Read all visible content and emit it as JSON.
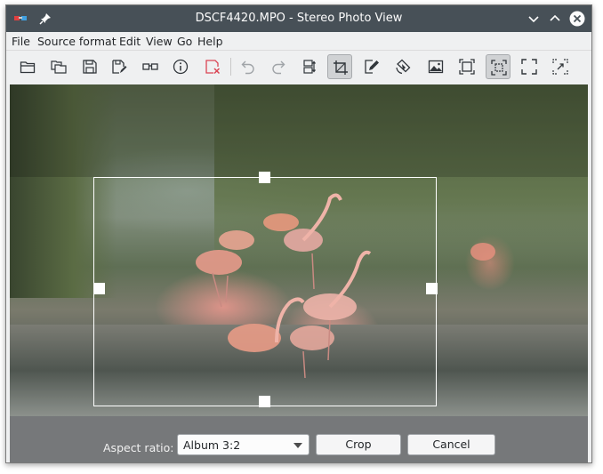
{
  "window": {
    "title": "DSCF4420.MPO - Stereo Photo View"
  },
  "menu": {
    "items": [
      {
        "label": "File"
      },
      {
        "label": "Source format"
      },
      {
        "label": "Edit"
      },
      {
        "label": "View"
      },
      {
        "label": "Go"
      },
      {
        "label": "Help"
      }
    ]
  },
  "toolbar": {
    "icons": [
      "open-folder-icon",
      "open-stereo-pair-icon",
      "save-icon",
      "save-as-icon",
      "stereo-glasses-icon",
      "info-icon",
      "close-image-icon",
      "undo-icon",
      "redo-icon",
      "swap-images-icon",
      "crop-icon",
      "edit-icon",
      "rotate-icon",
      "image-icon",
      "fit-window-icon",
      "fit-width-icon",
      "full-screen-icon",
      "zoom-icon"
    ],
    "active": [
      "crop-icon",
      "fit-width-icon"
    ]
  },
  "crop": {
    "aspect_label": "Aspect ratio:",
    "aspect_value": "Album 3:2",
    "crop_button": "Crop",
    "cancel_button": "Cancel"
  },
  "colors": {
    "titlebar": "#475057",
    "window_bg": "#eff0f1",
    "bottombar": "#76787a"
  }
}
